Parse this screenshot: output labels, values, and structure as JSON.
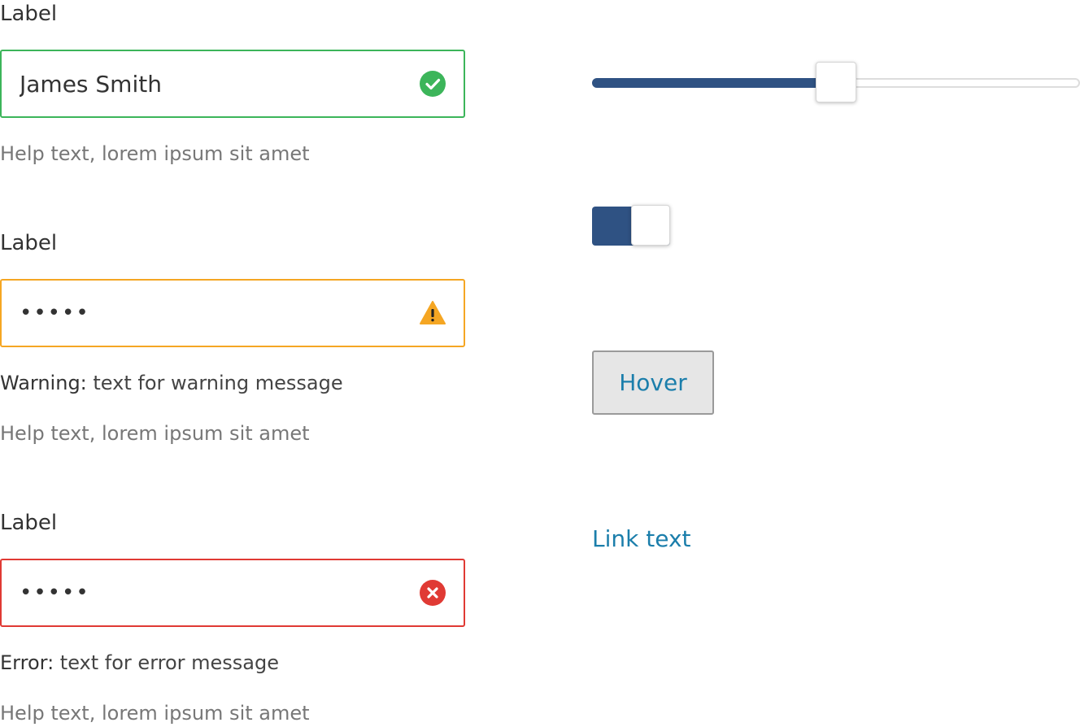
{
  "colors": {
    "valid": "#3cb55a",
    "warning": "#f5a623",
    "error": "#e03a34",
    "accent": "#2f5283",
    "link": "#1b7eab"
  },
  "form": {
    "fields": [
      {
        "label": "Label",
        "value": "James Smith",
        "state": "valid",
        "icon": "check-circle-icon",
        "help": "Help text, lorem ipsum sit amet"
      },
      {
        "label": "Label",
        "value": "•••••",
        "state": "warning",
        "icon": "warning-triangle-icon",
        "message_prefix": "Warning:",
        "message": " text for warning message",
        "help": "Help text, lorem ipsum sit amet"
      },
      {
        "label": "Label",
        "value": "•••••",
        "state": "error",
        "icon": "error-circle-icon",
        "message_prefix": "Error:",
        "message": " text for error message",
        "help": "Help text, lorem ipsum sit amet"
      }
    ]
  },
  "controls": {
    "slider": {
      "value": 0.5
    },
    "toggle": {
      "on": true
    },
    "hover_button": {
      "label": "Hover"
    },
    "link": {
      "text": "Link text"
    }
  }
}
